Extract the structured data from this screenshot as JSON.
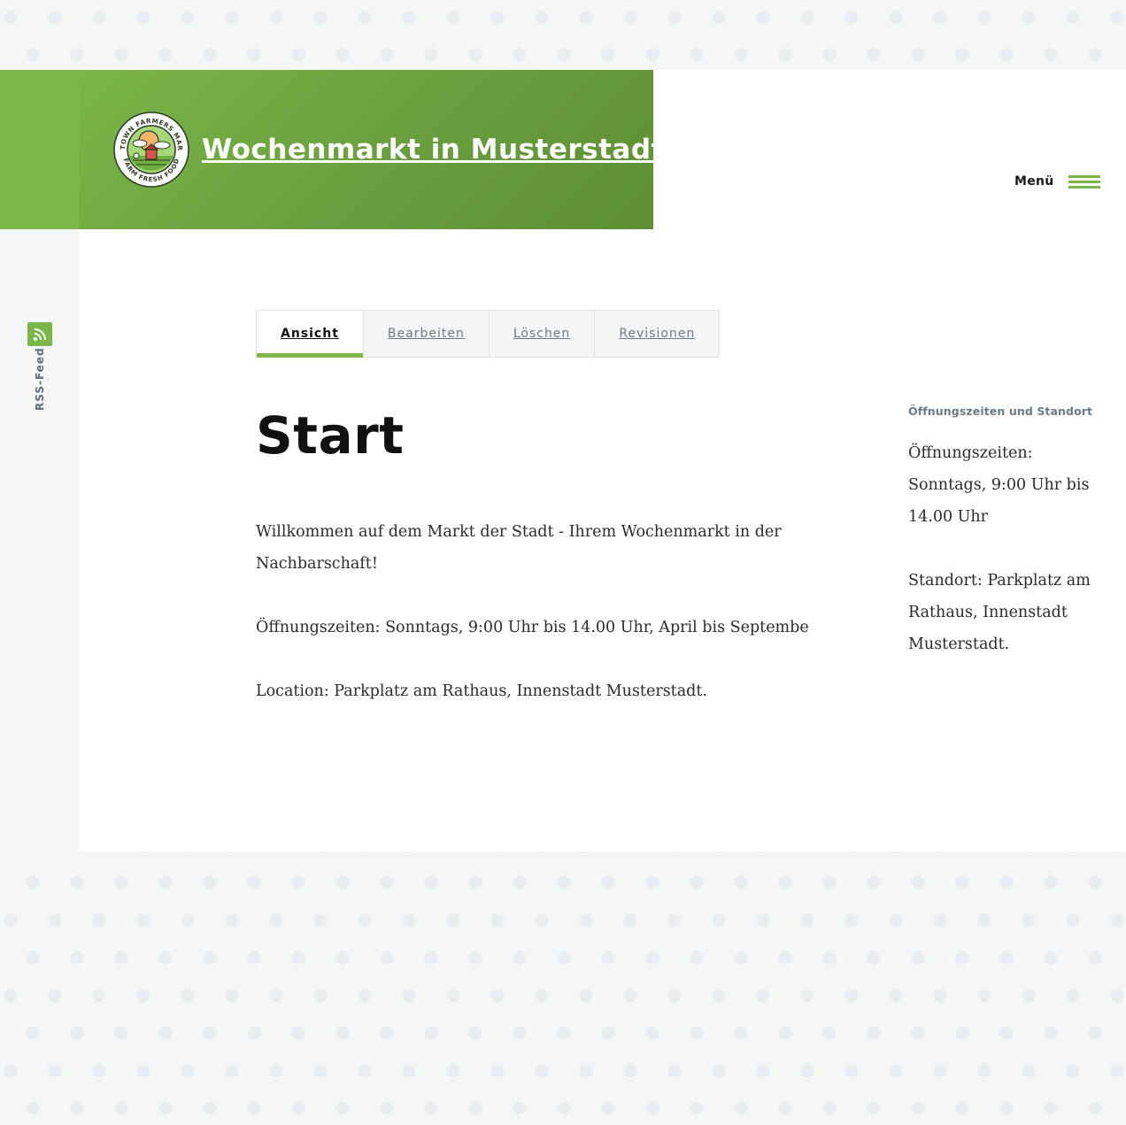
{
  "header": {
    "site_title": "Wochenmarkt in Musterstadt",
    "logo_text_top": "ANYTOWN FARMERS MARKET",
    "logo_text_bottom": "FARM FRESH FOOD",
    "menu_label": "Menü"
  },
  "rss": {
    "label": "RSS-Feed"
  },
  "tabs": [
    {
      "label": "Ansicht",
      "active": true
    },
    {
      "label": "Bearbeiten",
      "active": false
    },
    {
      "label": "Löschen",
      "active": false
    },
    {
      "label": "Revisionen",
      "active": false
    }
  ],
  "main": {
    "title": "Start",
    "paragraphs": [
      "Willkommen auf dem Markt der Stadt - Ihrem Wochenmarkt in der Nachbarschaft!",
      "Öffnungszeiten: Sonntags, 9:00 Uhr bis 14.00 Uhr, April bis Septembe",
      "Location: Parkplatz am Rathaus, Innenstadt Musterstadt."
    ]
  },
  "sidebar": {
    "heading": "Öffnungszeiten und Standort",
    "paragraphs": [
      "Öffnungszeiten: Sonntags, 9:00 Uhr bis 14.00 Uhr",
      "Standort: Parkplatz am Rathaus, Innenstadt Musterstadt."
    ]
  },
  "colors": {
    "accent": "#7ab648",
    "header_gradient_end": "#5e8f34",
    "muted_text": "#6b7a86"
  },
  "icons": [
    "rss-icon",
    "menu-hamburger-icon",
    "farmers-market-logo"
  ]
}
